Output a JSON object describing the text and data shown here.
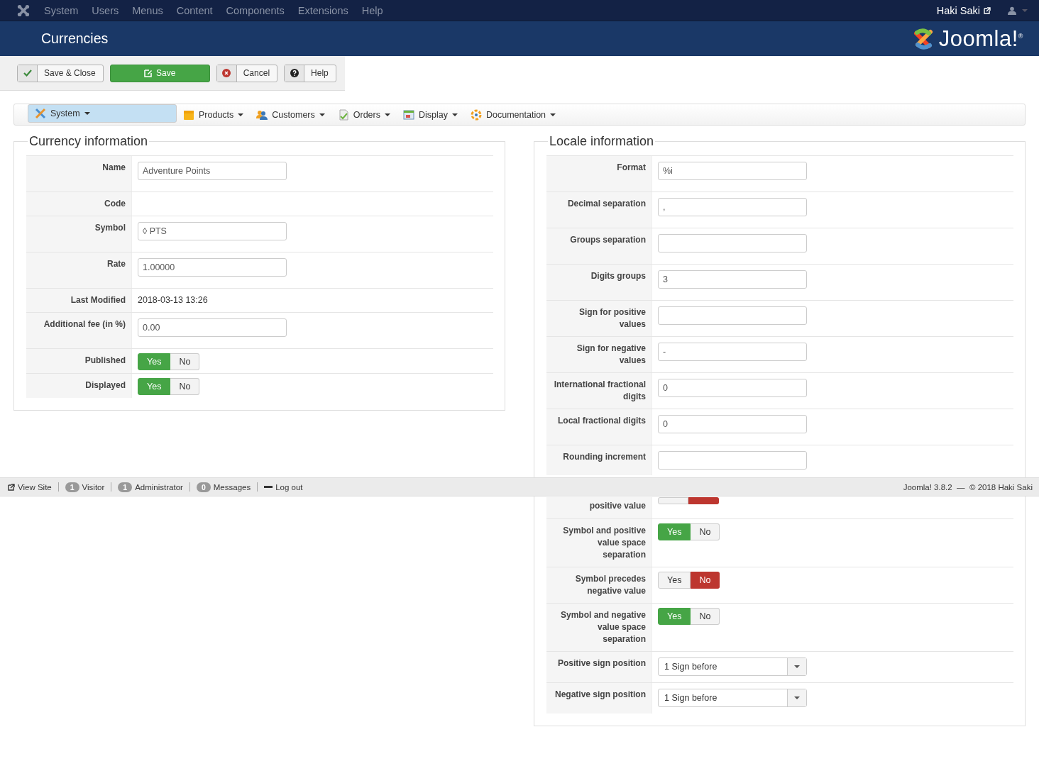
{
  "top_menu": {
    "items": [
      "System",
      "Users",
      "Menus",
      "Content",
      "Components",
      "Extensions",
      "Help"
    ],
    "user": "Haki Saki"
  },
  "header": {
    "title": "Currencies",
    "logo": "Joomla!$^{®}$"
  },
  "toolbar": [
    {
      "label": "Save & Close",
      "kind": "default"
    },
    {
      "label": "Save",
      "kind": "primary"
    },
    {
      "label": "Cancel",
      "kind": "default"
    },
    {
      "label": "Help",
      "kind": "default"
    }
  ],
  "submenu": [
    {
      "label": "System",
      "selected": true
    },
    {
      "label": "Products",
      "selected": false
    },
    {
      "label": "Customers",
      "selected": false
    },
    {
      "label": "Orders",
      "selected": false
    },
    {
      "label": "Display",
      "selected": false
    },
    {
      "label": "Documentation",
      "selected": false
    }
  ],
  "currency": {
    "legend": "Currency information",
    "rows": [
      {
        "label": "Name",
        "kind": "input",
        "value": "Adventure Points"
      },
      {
        "label": "Code",
        "kind": "blank"
      },
      {
        "label": "Symbol",
        "kind": "input",
        "value": "◊ PTS"
      },
      {
        "label": "Rate",
        "kind": "input",
        "value": "1.00000"
      },
      {
        "label": "Last Modified",
        "kind": "text",
        "value": "2018-03-13 13:26"
      },
      {
        "label": "Additional fee (in %)",
        "kind": "input",
        "value": "0.00"
      },
      {
        "label": "Published",
        "kind": "toggle",
        "options": [
          {
            "label": "Yes",
            "selected": true
          },
          {
            "label": "No",
            "selected": false
          }
        ]
      },
      {
        "label": "Displayed",
        "kind": "toggle",
        "options": [
          {
            "label": "Yes",
            "selected": true
          },
          {
            "label": "No",
            "selected": false
          }
        ]
      }
    ]
  },
  "locale": {
    "legend": "Locale information",
    "rows": [
      {
        "label": "Format",
        "kind": "input",
        "value": "%i"
      },
      {
        "label": "Decimal separation",
        "kind": "input",
        "value": ","
      },
      {
        "label": "Groups separation",
        "kind": "input"
      },
      {
        "label": "Digits groups",
        "kind": "input",
        "value": "3"
      },
      {
        "label": "Sign for positive values",
        "kind": "input"
      },
      {
        "label": "Sign for negative values",
        "kind": "input",
        "value": "-"
      },
      {
        "label": "International fractional digits",
        "kind": "input",
        "value": "0"
      },
      {
        "label": "Local fractional digits",
        "kind": "input",
        "value": "0"
      },
      {
        "label": "Rounding increment",
        "kind": "input"
      },
      {
        "label": "positive value",
        "kind": "covered_toggle",
        "options": [
          {
            "selected": false
          },
          {
            "selected": true
          }
        ]
      },
      {
        "label": "Symbol and positive value space separation",
        "kind": "toggle",
        "options": [
          {
            "label": "Yes",
            "selected": true
          },
          {
            "label": "No",
            "selected": false
          }
        ]
      },
      {
        "label": "Symbol precedes negative value",
        "kind": "toggle",
        "options": [
          {
            "label": "Yes",
            "selected": false
          },
          {
            "label": "No",
            "selected": true
          }
        ]
      },
      {
        "label": "Symbol and negative value space separation",
        "kind": "toggle",
        "options": [
          {
            "label": "Yes",
            "selected": true
          },
          {
            "label": "No",
            "selected": false
          }
        ]
      },
      {
        "label": "Positive sign position",
        "kind": "select",
        "value": "1 Sign before"
      },
      {
        "label": "Negative sign position",
        "kind": "select",
        "value": "1 Sign before"
      }
    ]
  },
  "status_bar": {
    "links": [
      {
        "label": "View Site"
      },
      {
        "badge": "1",
        "label": "Visitor"
      },
      {
        "badge": "1",
        "label": "Administrator"
      },
      {
        "badge": "0",
        "label": "Messages"
      },
      {
        "label": "Log out"
      }
    ],
    "version": "Joomla! 3.8.2  —  © 2018 Haki Saki"
  }
}
